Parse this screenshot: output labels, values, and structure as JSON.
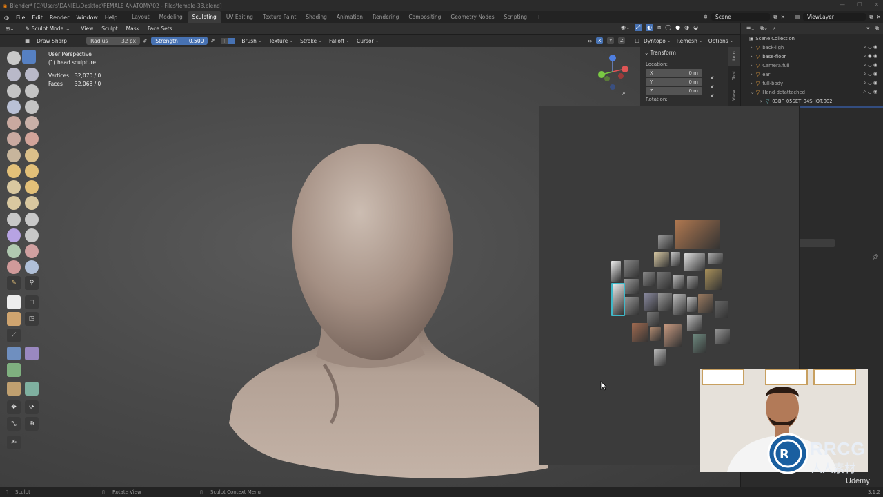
{
  "window": {
    "title": "Blender* [C:\\Users\\DANIEL\\Desktop\\FEMALE ANATOMY\\02 - Files\\female-33.blend]"
  },
  "menu": [
    "File",
    "Edit",
    "Render",
    "Window",
    "Help"
  ],
  "workspaces": [
    "Layout",
    "Modeling",
    "Sculpting",
    "UV Editing",
    "Texture Paint",
    "Shading",
    "Animation",
    "Rendering",
    "Compositing",
    "Geometry Nodes",
    "Scripting"
  ],
  "active_workspace": "Sculpting",
  "scene": "Scene",
  "view_layer": "ViewLayer",
  "header": {
    "mode": "Sculpt Mode",
    "menus": [
      "View",
      "Sculpt",
      "Mask",
      "Face Sets"
    ]
  },
  "tool_settings": {
    "brush": "Draw Sharp",
    "radius_label": "Radius",
    "radius_value": "32 px",
    "strength_label": "Strength",
    "strength_value": "0.500",
    "strength_fraction": 0.5,
    "dropdowns": [
      "Brush",
      "Texture",
      "Stroke",
      "Falloff",
      "Cursor"
    ],
    "right": [
      "Dyntopo",
      "Remesh",
      "Options"
    ],
    "axes": [
      "X",
      "Y",
      "Z"
    ]
  },
  "viewport": {
    "view_name": "User Perspective",
    "object_name": "(1) head sculpture",
    "vertices_label": "Vertices",
    "vertices_value": "32,070 / 0",
    "faces_label": "Faces",
    "faces_value": "32,068 / 0"
  },
  "npanel": {
    "panel": "Transform",
    "location_label": "Location:",
    "x_label": "X",
    "x_value": "0 m",
    "y_label": "Y",
    "y_value": "0 m",
    "z_label": "Z",
    "z_value": "0 m",
    "rotation_label": "Rotation:",
    "tabs": [
      "Item",
      "Tool",
      "View"
    ]
  },
  "outliner": {
    "root": "Scene Collection",
    "items": [
      "back-ligh",
      "base-floor",
      "Camera.full",
      "ear",
      "full-body",
      "Hand-detattached",
      "03BF_05SET_04SHOT.002"
    ]
  },
  "status_bar": {
    "left": "Sculpt",
    "middle": "Rotate View",
    "right": "Sculpt Context Menu",
    "version": "3.1.2"
  },
  "overlay": {
    "watermark_line1": "RRCG",
    "watermark_line2": "人人素材",
    "platform": "Udemy"
  },
  "colors": {
    "accent": "#4772b3",
    "selection": "#334d80",
    "sculpt_clay": "#b8a498"
  }
}
